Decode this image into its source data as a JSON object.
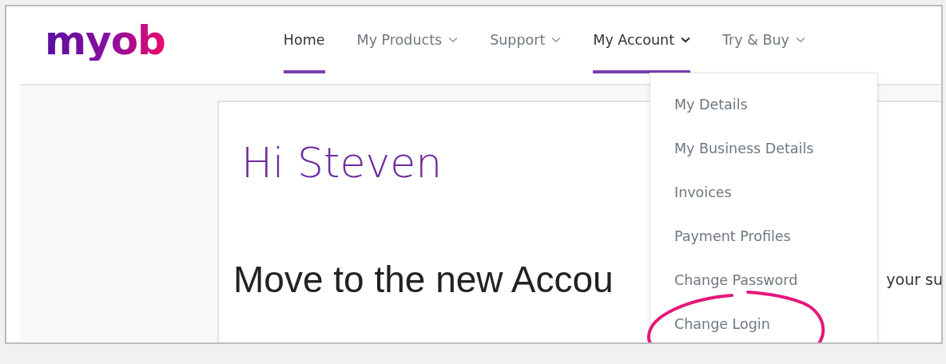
{
  "logo": {
    "text": "myob"
  },
  "nav": [
    {
      "label": "Home",
      "selected": true,
      "dropdown": false,
      "expanded": false
    },
    {
      "label": "My Products",
      "selected": false,
      "dropdown": true,
      "expanded": false
    },
    {
      "label": "Support",
      "selected": false,
      "dropdown": true,
      "expanded": false
    },
    {
      "label": "My Account",
      "selected": true,
      "dropdown": true,
      "expanded": true
    },
    {
      "label": "Try & Buy",
      "selected": false,
      "dropdown": true,
      "expanded": false
    }
  ],
  "account_menu": [
    {
      "label": "My Details",
      "circled": false
    },
    {
      "label": "My Business Details",
      "circled": false
    },
    {
      "label": "Invoices",
      "circled": false
    },
    {
      "label": "Payment Profiles",
      "circled": false
    },
    {
      "label": "Change Password",
      "circled": false
    },
    {
      "label": "Change Login",
      "circled": true
    }
  ],
  "greeting": "Hi Steven",
  "heading": "Move to the new Accou",
  "side_text": "your su"
}
